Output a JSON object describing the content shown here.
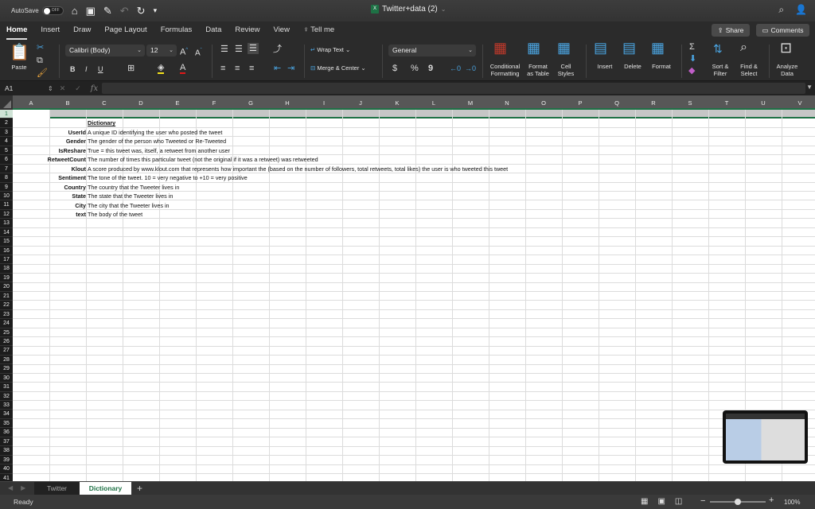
{
  "titlebar": {
    "autosave_label": "AutoSave",
    "autosave_state": "OFF",
    "document_title": "Twitter+data (2)",
    "file_icon_label": "X"
  },
  "tabs": [
    "Home",
    "Insert",
    "Draw",
    "Page Layout",
    "Formulas",
    "Data",
    "Review",
    "View",
    "Tell me"
  ],
  "active_tab": "Home",
  "header_buttons": {
    "share": "Share",
    "comments": "Comments"
  },
  "ribbon": {
    "paste": "Paste",
    "font_name": "Calibri (Body)",
    "font_size": "12",
    "bold": "B",
    "italic": "I",
    "underline": "U",
    "wrap_text": "Wrap Text",
    "merge_center": "Merge & Center",
    "number_format": "General",
    "currency": "$",
    "percent": "%",
    "comma": "9",
    "conditional_formatting": [
      "Conditional",
      "Formatting"
    ],
    "format_as_table": [
      "Format",
      "as Table"
    ],
    "cell_styles": [
      "Cell",
      "Styles"
    ],
    "insert": "Insert",
    "delete": "Delete",
    "format": "Format",
    "sort_filter": [
      "Sort &",
      "Filter"
    ],
    "find_select": [
      "Find &",
      "Select"
    ],
    "analyze_data": [
      "Analyze",
      "Data"
    ]
  },
  "formula_bar": {
    "name_box": "A1",
    "fx": "fx",
    "value": ""
  },
  "columns": [
    "A",
    "B",
    "C",
    "D",
    "E",
    "F",
    "G",
    "H",
    "I",
    "J",
    "K",
    "L",
    "M",
    "N",
    "O",
    "P",
    "Q",
    "R",
    "S",
    "T",
    "U",
    "V"
  ],
  "row_count": 41,
  "selected_cell": "A1",
  "sheet": {
    "title": "Dictionary",
    "entries": [
      {
        "key": "UserId",
        "desc": "A unique ID identifying the user who posted the tweet"
      },
      {
        "key": "Gender",
        "desc": "The gender of the person who Tweeted or Re-Tweeted"
      },
      {
        "key": "IsReshare",
        "desc": "True = this tweet was, itself, a retweet from another user"
      },
      {
        "key": "RetweetCount",
        "desc": "The number of times this particular tweet (not the original if it was a retweet) was retweeted"
      },
      {
        "key": "Klout",
        "desc": "A score produced by www.klout.com that represents how important the (based on the number of followers, total retweets, total likes) the user is who tweeted this tweet"
      },
      {
        "key": "Sentiment",
        "desc": "The tone of the tweet.  10 = very negative to +10 = very positive"
      },
      {
        "key": "Country",
        "desc": "The country that the Tweeter lives in"
      },
      {
        "key": "State",
        "desc": "The state that the Tweeter lives in"
      },
      {
        "key": "City",
        "desc": "The city that the Tweeter lives in"
      },
      {
        "key": "text",
        "desc": "The body of the tweet"
      }
    ]
  },
  "sheet_tabs": [
    {
      "label": "Twitter",
      "active": false
    },
    {
      "label": "Dictionary",
      "active": true
    }
  ],
  "add_sheet": "+",
  "status": {
    "text": "Ready",
    "zoom": "100%",
    "zoom_percent": 100
  },
  "colors": {
    "accent": "#1e7145",
    "header_bg": "#575757"
  }
}
